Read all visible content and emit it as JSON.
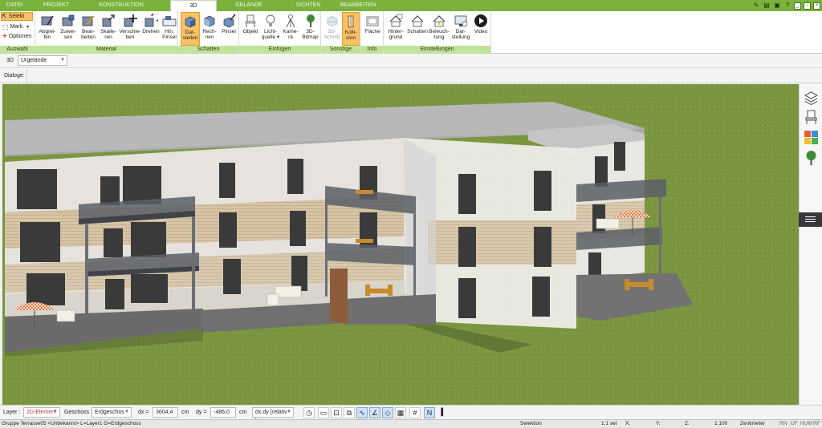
{
  "menu": {
    "tabs": [
      {
        "label": "DATEI"
      },
      {
        "label": "PROJEKT"
      },
      {
        "label": "KONSTRUKTION"
      },
      {
        "label": "3D"
      },
      {
        "label": "GELÄNDE"
      },
      {
        "label": "SICHTEN"
      },
      {
        "label": "BEARBEITEN"
      }
    ],
    "active_tab": "3D",
    "window_controls": [
      "_",
      "▫",
      "×"
    ]
  },
  "ribbon": {
    "auswahl": {
      "label": "Auswahl",
      "selekt": "Selekt",
      "mark": "Mark.",
      "optionen": "Optionen"
    },
    "material": {
      "label": "Material",
      "buttons": [
        {
          "line1": "Abgrei-",
          "line2": "fen",
          "icon": "eyedropper-icon"
        },
        {
          "line1": "Zuwei-",
          "line2": "sen",
          "icon": "bucket-icon"
        },
        {
          "line1": "Bear-",
          "line2": "beiten",
          "icon": "edit-texture-icon"
        },
        {
          "line1": "Skalie-",
          "line2": "ren",
          "icon": "scale-icon"
        },
        {
          "line1": "Verschie-",
          "line2": "ben",
          "icon": "move-icon"
        },
        {
          "line1": "Drehen",
          "line2": "",
          "icon": "rotate-icon"
        },
        {
          "line1": "Hin.",
          "line2": "Pinsel",
          "icon": "brush-add-icon"
        }
      ]
    },
    "schatten": {
      "label": "Schatten",
      "buttons": [
        {
          "line1": "Dar-",
          "line2": "stellen",
          "icon": "shadow-display-icon",
          "active": true
        },
        {
          "line1": "Rech-",
          "line2": "nen",
          "icon": "shadow-calc-icon"
        },
        {
          "line1": "Pinsel",
          "line2": "",
          "icon": "shadow-brush-icon"
        }
      ]
    },
    "einfuegen": {
      "label": "Einfügen",
      "buttons": [
        {
          "line1": "Objekt",
          "line2": "",
          "icon": "chair-icon"
        },
        {
          "line1": "Licht-",
          "line2": "quelle ▾",
          "icon": "lightbulb-icon"
        },
        {
          "line1": "Kame-",
          "line2": "ra",
          "icon": "camera-icon"
        },
        {
          "line1": "3D-",
          "line2": "Bitmap",
          "icon": "tree-bitmap-icon"
        }
      ]
    },
    "sonstige": {
      "label": "Sonstige",
      "buttons": [
        {
          "line1": "3D-",
          "line2": "Schnitt",
          "icon": "section-icon",
          "disabled": true
        },
        {
          "line1": "Kolli-",
          "line2": "sion",
          "icon": "collision-icon",
          "active": true
        }
      ]
    },
    "info": {
      "label": "Info",
      "buttons": [
        {
          "line1": "Fläche",
          "line2": "",
          "icon": "area-icon"
        }
      ]
    },
    "einstellungen": {
      "label": "Einstellungen",
      "buttons": [
        {
          "line1": "Hinter-",
          "line2": "grund",
          "icon": "background-icon"
        },
        {
          "line1": "Schatten",
          "line2": "",
          "icon": "shadow-settings-icon"
        },
        {
          "line1": "Beleuch-",
          "line2": "tung",
          "icon": "lighting-icon"
        },
        {
          "line1": "Dar-",
          "line2": "stellung",
          "icon": "display-icon"
        },
        {
          "line1": "Video",
          "line2": "",
          "icon": "play-icon"
        }
      ]
    }
  },
  "view_bar": {
    "mode": "3D",
    "terrain_select": "Urgelände",
    "dialog_label": "Dialoge:"
  },
  "bottom_bar": {
    "layer_label": "Layer :",
    "layer_value": "2D-Elemen",
    "geschoss_label": "Geschoss :",
    "geschoss_value": "Erdgeschos",
    "dx_label": "dx =",
    "dx_value": "3604,4",
    "dx_unit": "cm",
    "dy_label": "dy =",
    "dy_value": "-486,0",
    "dy_unit": "cm",
    "coord_mode": "dx,dy (relativ ka"
  },
  "status_bar": {
    "group_info": "Gruppe Terrasse05 <Unbekannt> L=Layer1 G=Erdgeschoss",
    "mode": "Selektion",
    "selection_count": "1:1 sel",
    "x_label": "X:",
    "y_label": "Y:",
    "z_label": "Z:",
    "scale": "1:100",
    "unit": "Zentimeter",
    "flags": [
      "RN",
      "UF",
      "NUM",
      "RF"
    ]
  },
  "colors": {
    "menu_green": "#7ab23c",
    "group_label_green": "#c2e39a",
    "active_orange": "#fbc166",
    "grass": "#7a9640",
    "sky": "#ffffff"
  }
}
